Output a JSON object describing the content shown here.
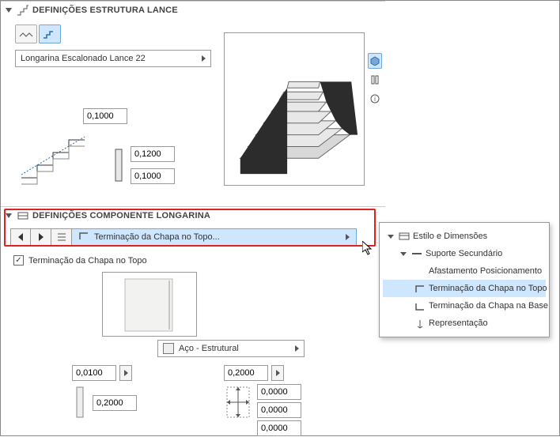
{
  "section1": {
    "title": "DEFINIÇÕES ESTRUTURA LANCE",
    "dropdown_label": "Longarina Escalonado Lance 22",
    "values": {
      "top_value": "0,1000",
      "mid_value": "0,1200",
      "bottom_value": "0,1000"
    }
  },
  "section2": {
    "title": "DEFINIÇÕES COMPONENTE LONGARINA",
    "dropdown_label": "Terminação da Chapa no Topo...",
    "checkbox_label": "Terminação da Chapa no Topo",
    "checkbox_checked": true,
    "material_label": "Aço - Estrutural",
    "dims": {
      "d1": "0,0100",
      "d2": "0,2000",
      "d3": "0,2000",
      "d4": "0,0000",
      "d5": "0,0000",
      "d6": "0,0000"
    }
  },
  "popup": {
    "items": [
      {
        "label": "Estilo e Dimensões",
        "icon": "panel-icon"
      },
      {
        "label": "Suporte Secundário",
        "icon": "beam-icon"
      },
      {
        "label": "Afastamento Posicionamento",
        "icon": ""
      },
      {
        "label": "Terminação da Chapa no Topo",
        "icon": "plate-top-icon",
        "selected": true
      },
      {
        "label": "Terminação da Chapa na Base",
        "icon": "plate-bottom-icon"
      },
      {
        "label": "Representação",
        "icon": "repr-icon"
      }
    ]
  }
}
